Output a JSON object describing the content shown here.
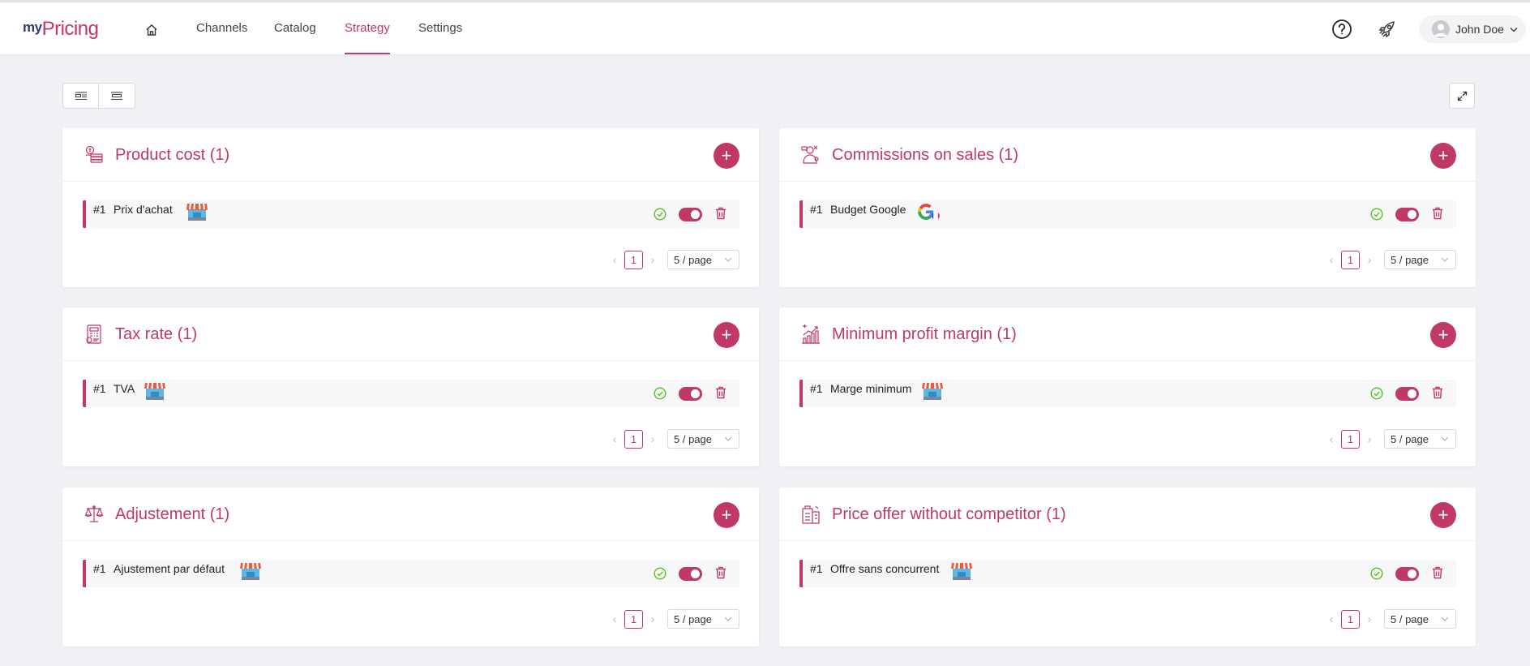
{
  "header": {
    "logo_my": "my",
    "logo_pricing": "Pricing",
    "home_icon": "home-icon",
    "menu": [
      {
        "label": "Channels"
      },
      {
        "label": "Catalog"
      },
      {
        "label": "Strategy",
        "active": true
      },
      {
        "label": "Settings"
      }
    ],
    "help_icon": "question-circle-icon",
    "rocket_icon": "rocket-icon",
    "user": {
      "name": "John Doe"
    }
  },
  "toolbar": {
    "view_icons": [
      "two-column-view-icon",
      "single-column-view-icon"
    ],
    "expand_icon": "expand-icon"
  },
  "cards": [
    {
      "title": "Product cost (1)",
      "icon": "product-cost-icon",
      "rule": {
        "num": "#1",
        "name": "Prix d'achat",
        "badge": "store-icon",
        "enabled": true
      },
      "pagination": {
        "page": "1",
        "size": "5 / page"
      }
    },
    {
      "title": "Commissions on sales (1)",
      "icon": "commission-icon",
      "rule": {
        "num": "#1",
        "name": "Budget Google",
        "badge": "google-france-icon",
        "enabled": true
      },
      "pagination": {
        "page": "1",
        "size": "5 / page"
      }
    },
    {
      "title": "Tax rate (1)",
      "icon": "tax-rate-icon",
      "rule": {
        "num": "#1",
        "name": "TVA",
        "badge": "store-icon",
        "enabled": true
      },
      "pagination": {
        "page": "1",
        "size": "5 / page"
      }
    },
    {
      "title": "Minimum profit margin (1)",
      "icon": "profit-chart-icon",
      "rule": {
        "num": "#1",
        "name": "Marge minimum",
        "badge": "store-icon",
        "enabled": true
      },
      "pagination": {
        "page": "1",
        "size": "5 / page"
      }
    },
    {
      "title": "Adjustement (1)",
      "icon": "balance-scale-icon",
      "rule": {
        "num": "#1",
        "name": "Ajustement par défaut",
        "badge": "store-icon",
        "enabled": true
      },
      "pagination": {
        "page": "1",
        "size": "5 / page"
      }
    },
    {
      "title": "Price offer without competitor (1)",
      "icon": "price-tag-icon",
      "rule": {
        "num": "#1",
        "name": "Offre sans concurrent",
        "badge": "store-icon",
        "enabled": true
      },
      "pagination": {
        "page": "1",
        "size": "5 / page"
      }
    }
  ],
  "colors": {
    "accent": "#c03964",
    "logo_dark": "#2b3e74",
    "background": "#f0f1f5",
    "success": "#52c41a"
  }
}
